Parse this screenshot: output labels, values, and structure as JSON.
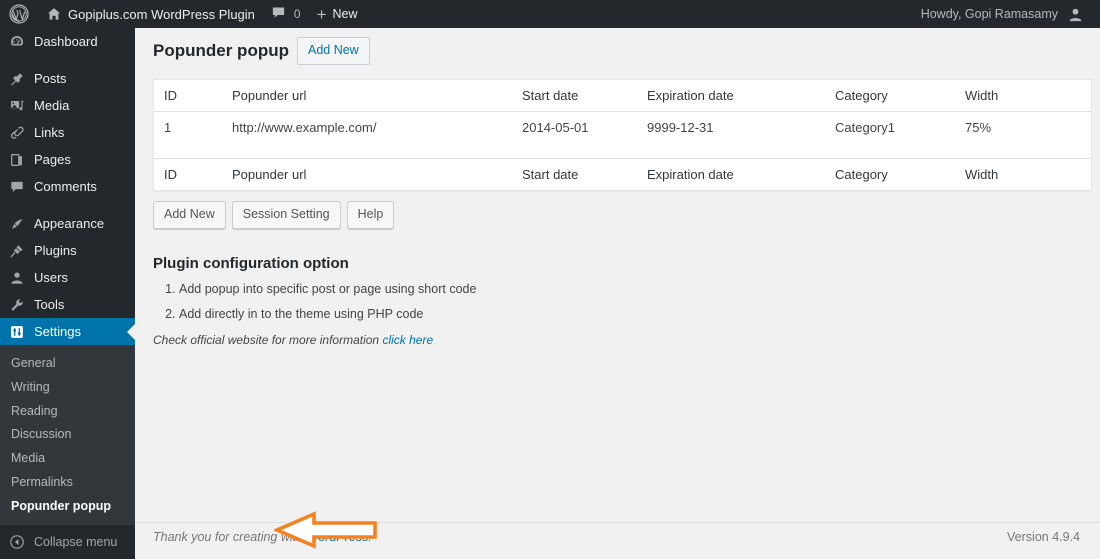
{
  "adminbar": {
    "wp_logo_name": "wordpress-logo-icon",
    "home_icon": "home-icon",
    "site_name": "Gopiplus.com WordPress Plugin",
    "comments_icon": "comment-bubble-icon",
    "comments_count": "0",
    "new_plus": "+",
    "new_label": "New",
    "howdy": "Howdy, Gopi Ramasamy",
    "avatar_icon": "user-avatar-icon"
  },
  "sidebar": {
    "items": [
      {
        "label": "Dashboard",
        "icon": "dashboard-icon",
        "sep_after": true
      },
      {
        "label": "Posts",
        "icon": "pin-icon",
        "sep_after": false
      },
      {
        "label": "Media",
        "icon": "media-icon",
        "sep_after": false
      },
      {
        "label": "Links",
        "icon": "link-icon",
        "sep_after": false
      },
      {
        "label": "Pages",
        "icon": "page-icon",
        "sep_after": false
      },
      {
        "label": "Comments",
        "icon": "comment-icon",
        "sep_after": true
      },
      {
        "label": "Appearance",
        "icon": "appearance-brush-icon",
        "sep_after": false
      },
      {
        "label": "Plugins",
        "icon": "plugin-plug-icon",
        "sep_after": false
      },
      {
        "label": "Users",
        "icon": "users-icon",
        "sep_after": false
      },
      {
        "label": "Tools",
        "icon": "tools-wrench-icon",
        "sep_after": false
      },
      {
        "label": "Settings",
        "icon": "settings-sliders-icon",
        "sep_after": false,
        "current": true
      }
    ],
    "submenu": [
      {
        "label": "General",
        "current": false
      },
      {
        "label": "Writing",
        "current": false
      },
      {
        "label": "Reading",
        "current": false
      },
      {
        "label": "Discussion",
        "current": false
      },
      {
        "label": "Media",
        "current": false
      },
      {
        "label": "Permalinks",
        "current": false
      },
      {
        "label": "Popunder popup",
        "current": true
      }
    ],
    "collapse": {
      "label": "Collapse menu",
      "icon": "collapse-arrow-left-icon"
    }
  },
  "page": {
    "title": "Popunder popup",
    "add_new_action": "Add New"
  },
  "table": {
    "columns": [
      "ID",
      "Popunder url",
      "Start date",
      "Expiration date",
      "Category",
      "Width"
    ],
    "rows": [
      {
        "id": "1",
        "url": "http://www.example.com/",
        "start_date": "2014-05-01",
        "expiration_date": "9999-12-31",
        "category": "Category1",
        "width": "75%"
      }
    ]
  },
  "buttons": [
    {
      "label": "Add New",
      "name": "add-new-button"
    },
    {
      "label": "Session Setting",
      "name": "session-setting-button"
    },
    {
      "label": "Help",
      "name": "help-button"
    }
  ],
  "config": {
    "title": "Plugin configuration option",
    "items": [
      "Add popup into specific post or page using short code",
      "Add directly in to the theme using PHP code"
    ],
    "note_text": "Check official website for more information ",
    "note_link": "click here"
  },
  "annotation": {
    "arrow": "left-pointing-arrow-annotation",
    "color": "#f58220"
  },
  "footer": {
    "thanks_prefix": "Thank you for creating with ",
    "thanks_link": "WordPress",
    "thanks_suffix": ".",
    "version": "Version 4.9.4"
  },
  "colors": {
    "admin_bar_bg": "#23282d",
    "menu_bg": "#23282d",
    "submenu_bg": "#32373c",
    "current_menu": "#0073aa",
    "content_bg": "#f1f1f1",
    "accent_link": "#0073aa",
    "annotation_orange": "#f58220"
  }
}
